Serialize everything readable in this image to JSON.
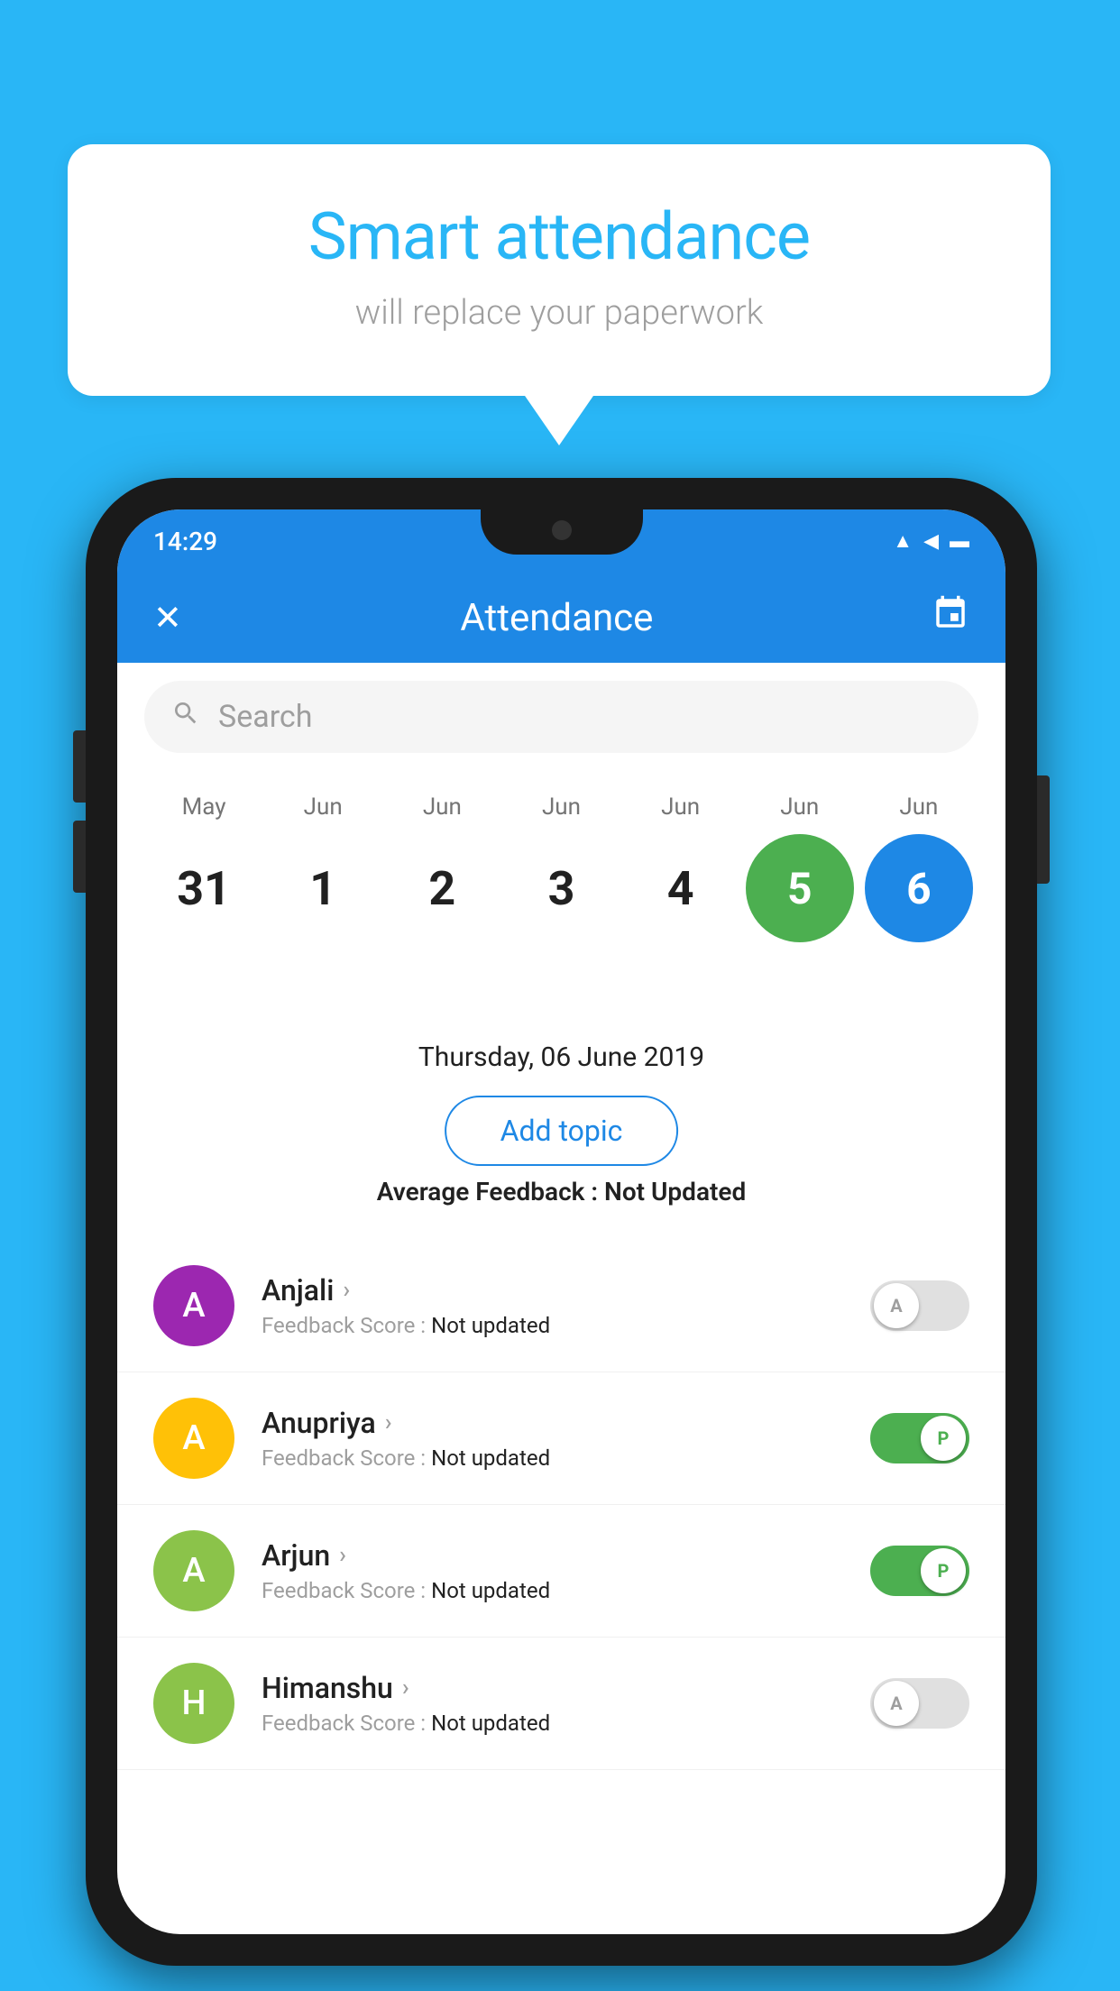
{
  "background_color": "#29b6f6",
  "speech_bubble": {
    "title": "Smart attendance",
    "subtitle": "will replace your paperwork"
  },
  "status_bar": {
    "time": "14:29",
    "icons": [
      "wifi",
      "signal",
      "battery"
    ]
  },
  "app_bar": {
    "title": "Attendance",
    "close_icon": "✕",
    "calendar_icon": "📅"
  },
  "search": {
    "placeholder": "Search"
  },
  "calendar": {
    "months": [
      "May",
      "Jun",
      "Jun",
      "Jun",
      "Jun",
      "Jun",
      "Jun"
    ],
    "dates": [
      "31",
      "1",
      "2",
      "3",
      "4",
      "5",
      "6"
    ],
    "today_index": 5,
    "selected_index": 6
  },
  "selected_date_label": "Thursday, 06 June 2019",
  "add_topic_button": "Add topic",
  "avg_feedback_label": "Average Feedback : ",
  "avg_feedback_value": "Not Updated",
  "students": [
    {
      "name": "Anjali",
      "avatar_letter": "A",
      "avatar_color": "#9c27b0",
      "feedback_label": "Feedback Score : ",
      "feedback_value": "Not updated",
      "toggle_state": "off",
      "toggle_label": "A"
    },
    {
      "name": "Anupriya",
      "avatar_letter": "A",
      "avatar_color": "#ffc107",
      "feedback_label": "Feedback Score : ",
      "feedback_value": "Not updated",
      "toggle_state": "on",
      "toggle_label": "P"
    },
    {
      "name": "Arjun",
      "avatar_letter": "A",
      "avatar_color": "#8bc34a",
      "feedback_label": "Feedback Score : ",
      "feedback_value": "Not updated",
      "toggle_state": "on",
      "toggle_label": "P"
    },
    {
      "name": "Himanshu",
      "avatar_letter": "H",
      "avatar_color": "#8bc34a",
      "feedback_label": "Feedback Score : ",
      "feedback_value": "Not updated",
      "toggle_state": "off",
      "toggle_label": "A"
    }
  ]
}
